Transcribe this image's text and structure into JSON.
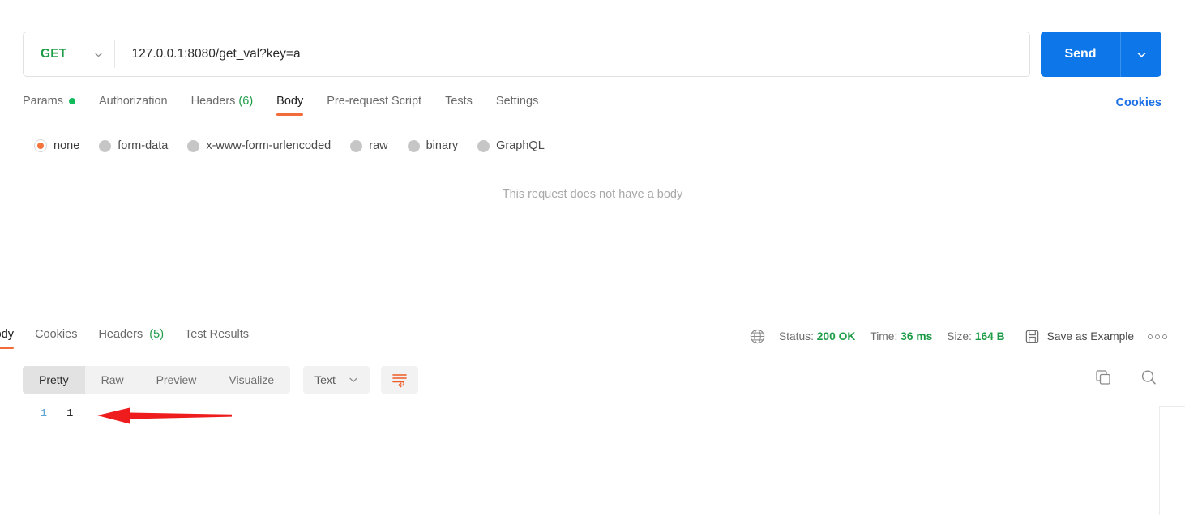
{
  "request": {
    "method": "GET",
    "method_caret_icon": "chevron-down-icon",
    "url": "127.0.0.1:8080/get_val?key=a",
    "send_label": "Send",
    "send_caret_icon": "chevron-down-icon",
    "cookies_link": "Cookies",
    "tabs": [
      {
        "label": "Params",
        "has_dot": true,
        "active": false
      },
      {
        "label": "Authorization",
        "active": false
      },
      {
        "label": "Headers",
        "count": "(6)",
        "active": false
      },
      {
        "label": "Body",
        "active": true
      },
      {
        "label": "Pre-request Script",
        "active": false
      },
      {
        "label": "Tests",
        "active": false
      },
      {
        "label": "Settings",
        "active": false
      }
    ],
    "body_types": [
      {
        "label": "none",
        "selected": true
      },
      {
        "label": "form-data",
        "selected": false
      },
      {
        "label": "x-www-form-urlencoded",
        "selected": false
      },
      {
        "label": "raw",
        "selected": false
      },
      {
        "label": "binary",
        "selected": false
      },
      {
        "label": "GraphQL",
        "selected": false
      }
    ],
    "empty_body_message": "This request does not have a body"
  },
  "response": {
    "tabs": [
      {
        "label": "Body",
        "active": true
      },
      {
        "label": "Cookies",
        "active": false
      },
      {
        "label": "Headers",
        "count": "(5)",
        "active": false
      },
      {
        "label": "Test Results",
        "active": false
      }
    ],
    "status": {
      "globe_icon": "globe-icon",
      "status_label": "Status:",
      "status_value": "200 OK",
      "time_label": "Time:",
      "time_value": "36 ms",
      "size_label": "Size:",
      "size_value": "164 B",
      "save_icon": "floppy-disk-icon",
      "save_as_example": "Save as Example",
      "kebab_icon": "more-options-icon"
    },
    "viewer": {
      "modes": [
        {
          "label": "Pretty",
          "active": true
        },
        {
          "label": "Raw",
          "active": false
        },
        {
          "label": "Preview",
          "active": false
        },
        {
          "label": "Visualize",
          "active": false
        }
      ],
      "format": "Text",
      "format_caret_icon": "chevron-down-icon",
      "wrap_icon": "word-wrap-icon",
      "copy_icon": "copy-icon",
      "search_icon": "search-icon"
    },
    "body_lines": [
      {
        "number": "1",
        "content": "1"
      }
    ]
  },
  "annotation": {
    "arrow_icon": "red-arrow-left-icon",
    "color": "#ee1c1c"
  },
  "colors": {
    "accent_orange": "#f26b3a",
    "send_blue": "#0d76e8",
    "link_blue": "#1a6ee8",
    "success_green": "#1d9c47",
    "dot_green": "#12bb5c"
  }
}
